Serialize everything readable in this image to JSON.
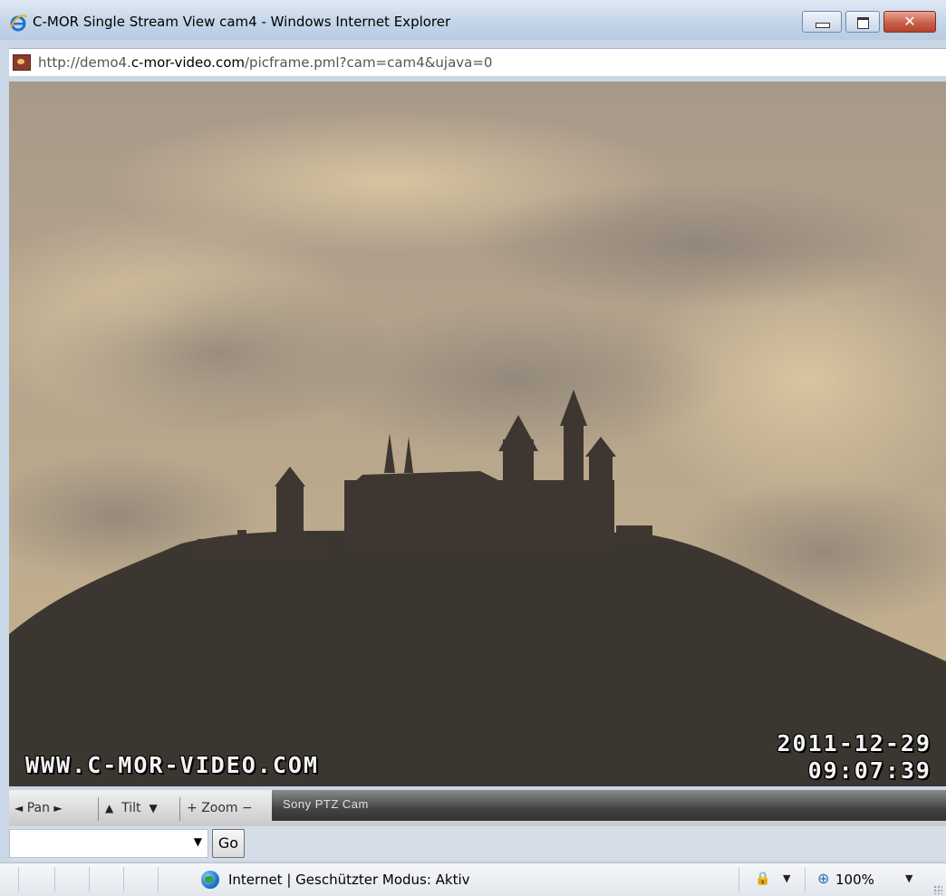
{
  "window": {
    "title": "C-MOR Single Stream View cam4 - Windows Internet Explorer",
    "close_glyph": "✕"
  },
  "address": {
    "url_prefix": "http://demo4.",
    "url_domain": "c-mor-video.com",
    "url_suffix": "/picframe.pml?cam=cam4&ujava=0"
  },
  "camera": {
    "watermark": "WWW.C-MOR-VIDEO.COM",
    "date": "2011-12-29",
    "time": "09:07:39"
  },
  "controls": {
    "pan_left": "◄",
    "pan_label": "Pan",
    "pan_right": "►",
    "tilt_up": "▲",
    "tilt_label": "Tilt",
    "tilt_down": "▼",
    "zoom_in": "+",
    "zoom_label": "Zoom",
    "zoom_out": "−",
    "camera_name": "Sony PTZ Cam"
  },
  "presets": {
    "selected": "",
    "go_label": "Go"
  },
  "status": {
    "zone": "Internet | Geschützter Modus: Aktiv",
    "zoom": "100%"
  },
  "icons": [
    "ie-logo-icon",
    "minimize-icon",
    "maximize-icon",
    "close-icon",
    "page-favicon-icon",
    "globe-icon",
    "lock-icon",
    "zoom-icon",
    "chevron-down-icon"
  ]
}
